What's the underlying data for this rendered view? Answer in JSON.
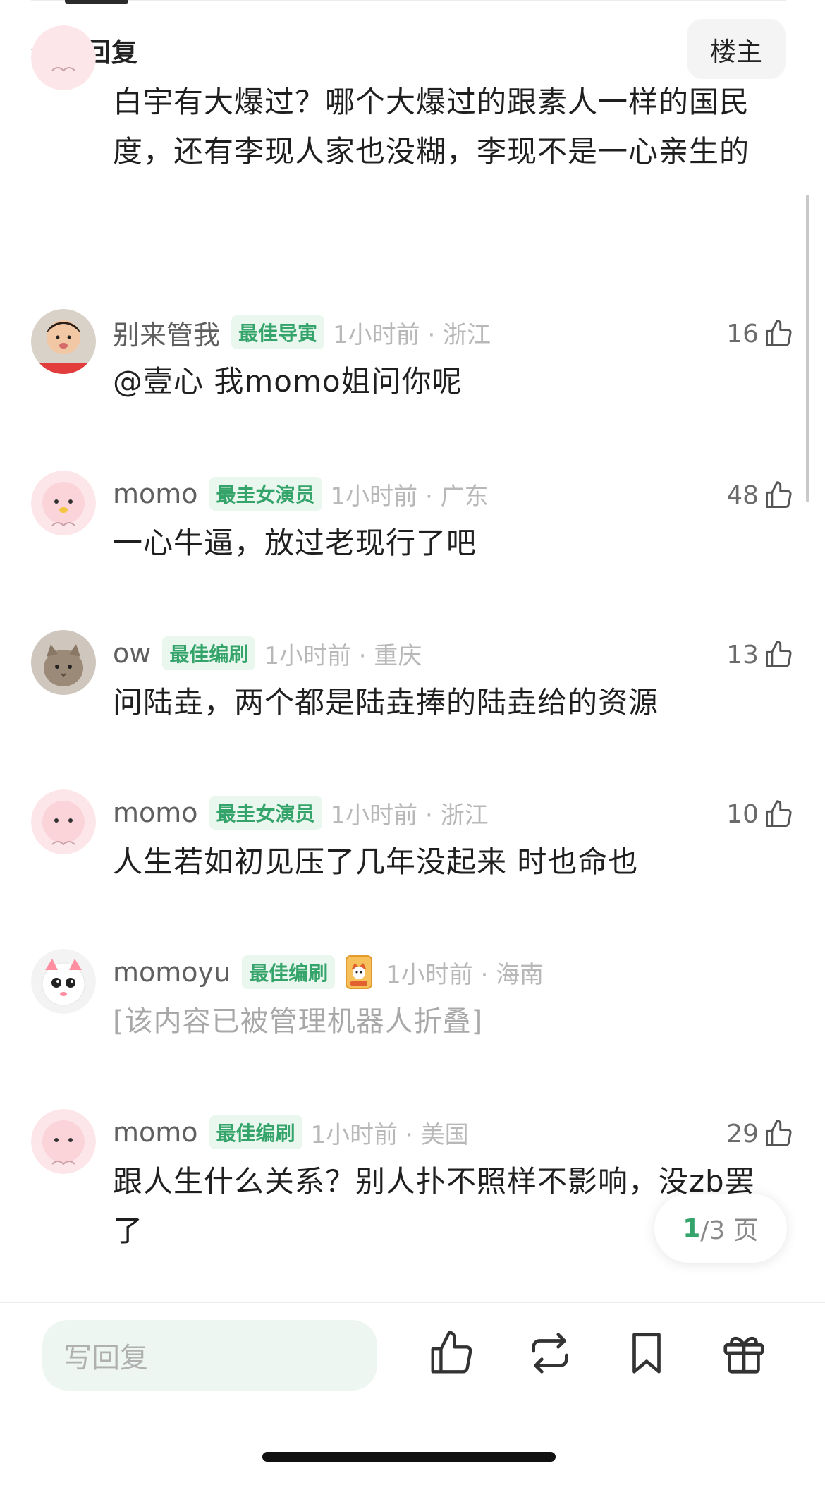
{
  "header": {
    "title": "全部回复",
    "owner_button": "楼主"
  },
  "first_comment": {
    "text": "白宇有大爆过？哪个大爆过的跟素人一样的国民度，还有李现人家也没糊，李现不是一心亲生的"
  },
  "comments": [
    {
      "name": "别来管我",
      "badge": "最佳导寅",
      "meta": "1小时前 · 浙江",
      "likes": "16",
      "text": "@壹心 我momo姐问你呢",
      "avatar": "child-photo"
    },
    {
      "name": "momo",
      "badge": "最圭女演员",
      "meta": "1小时前 · 广东",
      "likes": "48",
      "text": "一心牛逼，放过老现行了吧",
      "avatar": "pink-blob"
    },
    {
      "name": "ow",
      "badge": "最佳编刷",
      "meta": "1小时前 · 重庆",
      "likes": "13",
      "text": "问陆垚，两个都是陆垚捧的陆垚给的资源",
      "avatar": "cat-photo"
    },
    {
      "name": "momo",
      "badge": "最圭女演员",
      "meta": "1小时前 · 浙江",
      "likes": "10",
      "text": "人生若如初见压了几年没起来 时也命也",
      "avatar": "pink-blob"
    },
    {
      "name": "momoyu",
      "badge": "最佳编刷",
      "meta": "1小时前 · 海南",
      "likes": "",
      "text": "[该内容已被管理机器人折叠]",
      "avatar": "white-cat-cartoon"
    },
    {
      "name": "momo",
      "badge": "最佳编刷",
      "meta": "1小时前 · 美国",
      "likes": "29",
      "text": "跟人生什么关系？别人扑不照样不影响，没zb罢了",
      "avatar": "pink-blob"
    }
  ],
  "pager": {
    "current": "1",
    "rest": "/3 页"
  },
  "bottom_bar": {
    "reply_placeholder": "写回复"
  },
  "colors": {
    "accent": "#35a46a",
    "badge_bg": "#e9f7ef",
    "meta": "#b8b8b8"
  },
  "icons": [
    "thumbs-up-icon",
    "repost-icon",
    "bookmark-icon",
    "gift-icon"
  ]
}
